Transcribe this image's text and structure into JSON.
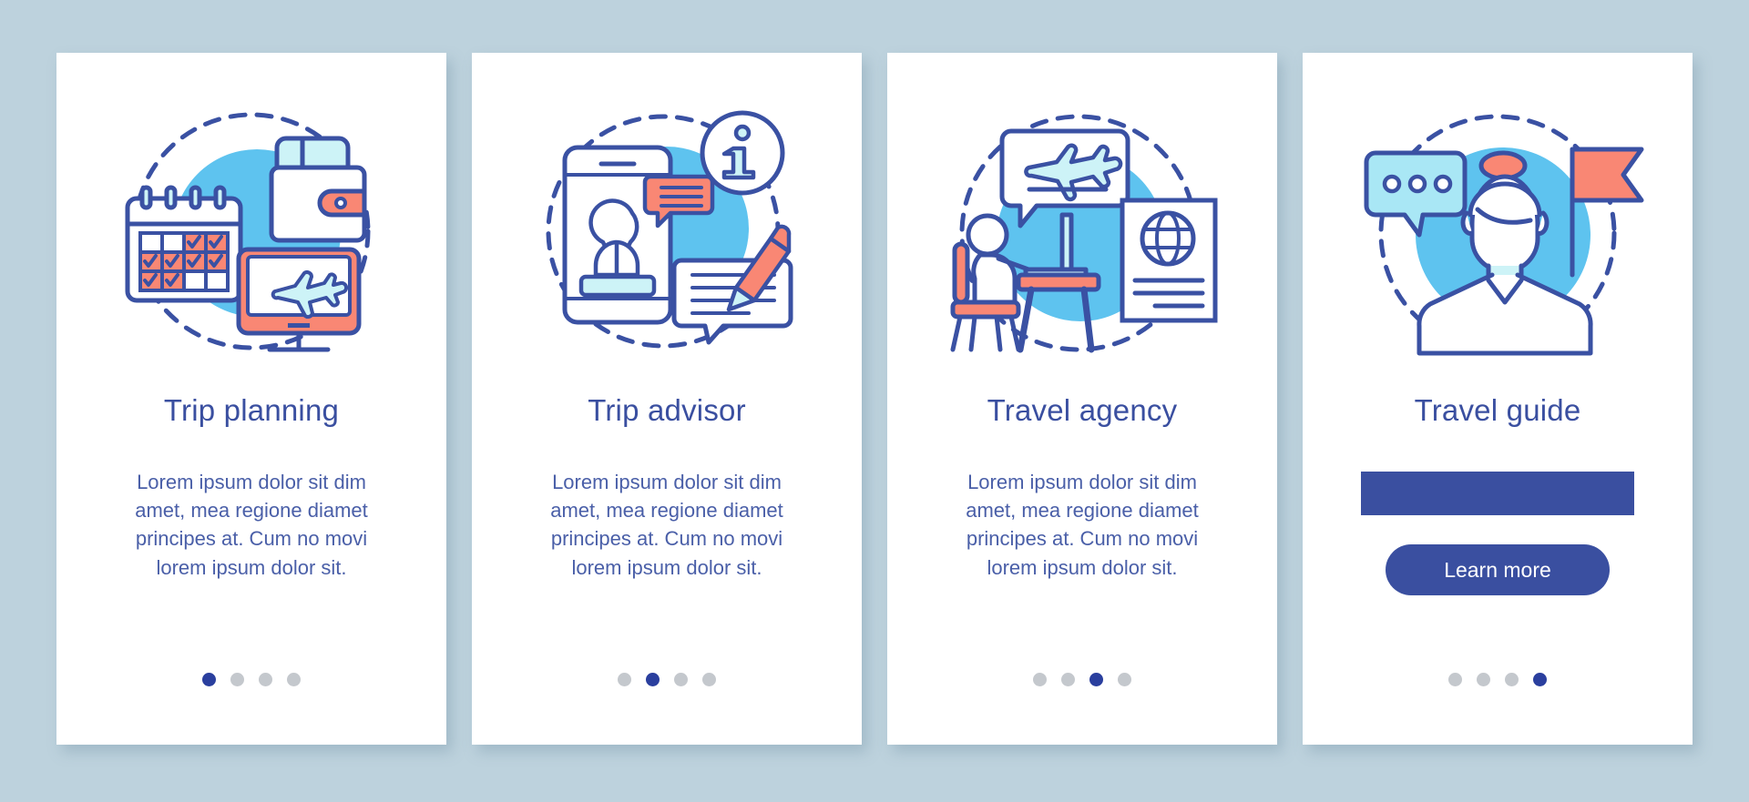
{
  "theme": {
    "background": "#bdd2dd",
    "card_background": "#ffffff",
    "accent_blue": "#3a4fa0",
    "dot_active": "#2a3f9e",
    "dot_inactive": "#c4c8cd",
    "illustration_circle": "#5ec3ef",
    "illustration_outline": "#3a51a3",
    "illustration_coral": "#f98774",
    "illustration_light_cyan": "#cdf3f7"
  },
  "screens": [
    {
      "id": "trip-planning",
      "icon": "calendar-wallet-monitor-icon",
      "title": "Trip planning",
      "description": "Lorem ipsum dolor sit dim amet, mea regione diamet principes at. Cum no movi lorem ipsum dolor sit.",
      "dots": {
        "count": 4,
        "active_index": 0
      },
      "has_placeholder_bar": false,
      "has_button": false,
      "button_label": ""
    },
    {
      "id": "trip-advisor",
      "icon": "smartphone-info-notepad-icon",
      "title": "Trip advisor",
      "description": "Lorem ipsum dolor sit dim amet, mea regione diamet principes at. Cum no movi lorem ipsum dolor sit.",
      "dots": {
        "count": 4,
        "active_index": 1
      },
      "has_placeholder_bar": false,
      "has_button": false,
      "button_label": ""
    },
    {
      "id": "travel-agency",
      "icon": "agent-desk-passport-icon",
      "title": "Travel agency",
      "description": "Lorem ipsum dolor sit dim amet, mea regione diamet principes at. Cum no movi lorem ipsum dolor sit.",
      "dots": {
        "count": 4,
        "active_index": 2
      },
      "has_placeholder_bar": false,
      "has_button": false,
      "button_label": ""
    },
    {
      "id": "travel-guide",
      "icon": "guide-person-flag-icon",
      "title": "Travel guide",
      "description": "",
      "dots": {
        "count": 4,
        "active_index": 3
      },
      "has_placeholder_bar": true,
      "has_button": true,
      "button_label": "Learn more"
    }
  ]
}
